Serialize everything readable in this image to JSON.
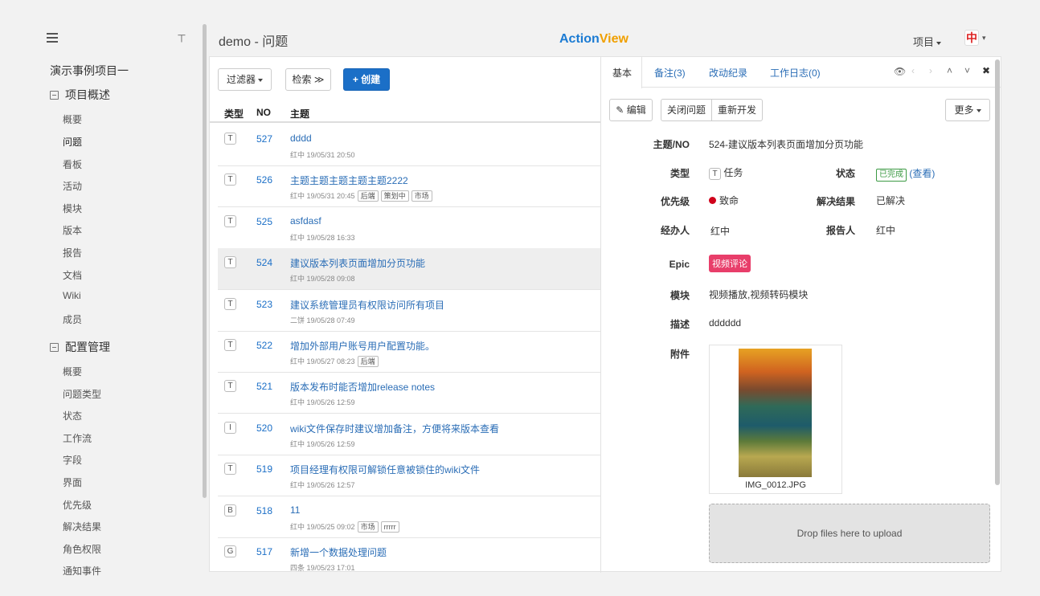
{
  "sidebar": {
    "project_name": "演示事例项目一",
    "groups": [
      {
        "label": "项目概述",
        "items": [
          "概要",
          "问题",
          "看板",
          "活动",
          "模块",
          "版本",
          "报告",
          "文档",
          "Wiki",
          "成员"
        ]
      },
      {
        "label": "配置管理",
        "items": [
          "概要",
          "问题类型",
          "状态",
          "工作流",
          "字段",
          "界面",
          "优先级",
          "解决结果",
          "角色权限",
          "通知事件"
        ]
      }
    ],
    "active_item": "问题"
  },
  "header": {
    "title": "demo - 问题",
    "brand_a": "Action",
    "brand_b": "View",
    "project_menu": "项目",
    "avatar": "中"
  },
  "toolbar": {
    "filter_label": "过滤器",
    "search_label": "检索 ≫",
    "create_label": "+ 创建"
  },
  "table": {
    "columns": [
      "类型",
      "NO",
      "主题"
    ],
    "rows": [
      {
        "type": "T",
        "no": "527",
        "title": "dddd",
        "meta": "红中 19/05/31 20:50",
        "tags": []
      },
      {
        "type": "T",
        "no": "526",
        "title": "主题主题主题主题主题2222",
        "meta": "红中 19/05/31 20:45",
        "tags": [
          "后端",
          "策划中",
          "市场"
        ]
      },
      {
        "type": "T",
        "no": "525",
        "title": "asfdasf",
        "meta": "红中 19/05/28 16:33",
        "tags": []
      },
      {
        "type": "T",
        "no": "524",
        "title": "建议版本列表页面增加分页功能",
        "meta": "红中 19/05/28 09:08",
        "tags": [],
        "selected": true
      },
      {
        "type": "T",
        "no": "523",
        "title": "建议系统管理员有权限访问所有项目",
        "meta": "二饼 19/05/28 07:49",
        "tags": []
      },
      {
        "type": "T",
        "no": "522",
        "title": "增加外部用户账号用户配置功能。",
        "meta": "红中 19/05/27 08:23",
        "tags": [
          "后端"
        ]
      },
      {
        "type": "T",
        "no": "521",
        "title": "版本发布时能否增加release notes",
        "meta": "红中 19/05/26 12:59",
        "tags": []
      },
      {
        "type": "I",
        "no": "520",
        "title": "wiki文件保存时建议增加备注，方便将来版本查看",
        "meta": "红中 19/05/26 12:59",
        "tags": []
      },
      {
        "type": "T",
        "no": "519",
        "title": "项目经理有权限可解锁任意被锁住的wiki文件",
        "meta": "红中 19/05/26 12:57",
        "tags": []
      },
      {
        "type": "B",
        "no": "518",
        "title": "11",
        "meta": "红中 19/05/25 09:02",
        "tags": [
          "市场",
          "rrrrr"
        ]
      },
      {
        "type": "G",
        "no": "517",
        "title": "新增一个数据处理问题",
        "meta": "四条 19/05/23 17:01",
        "tags": []
      }
    ]
  },
  "detail": {
    "tabs": [
      "基本",
      "备注(3)",
      "改动纪录",
      "工作日志(0)"
    ],
    "buttons": {
      "edit": "编辑",
      "close": "关闭问题",
      "reopen": "重新开发",
      "more": "更多"
    },
    "fields": {
      "subject_label": "主题/NO",
      "subject": "524-建议版本列表页面增加分页功能",
      "type_label": "类型",
      "type_badge": "T",
      "type": "任务",
      "status_label": "状态",
      "status": "已完成",
      "status_link": "(查看)",
      "priority_label": "优先级",
      "priority": "致命",
      "resolution_label": "解决结果",
      "resolution": "已解决",
      "assignee_label": "经办人",
      "assignee": "红中",
      "reporter_label": "报告人",
      "reporter": "红中",
      "epic_label": "Epic",
      "epic": "视频评论",
      "module_label": "模块",
      "module": "视频播放,视频转码模块",
      "desc_label": "描述",
      "desc": "dddddd",
      "attach_label": "附件",
      "attach_name": "IMG_0012.JPG"
    },
    "drop_text": "Drop files here to upload",
    "colors": {
      "accent": "#1b6fc7",
      "epic": "#e83e6a",
      "priority": "#d0021b",
      "done": "#3c9a44"
    }
  }
}
